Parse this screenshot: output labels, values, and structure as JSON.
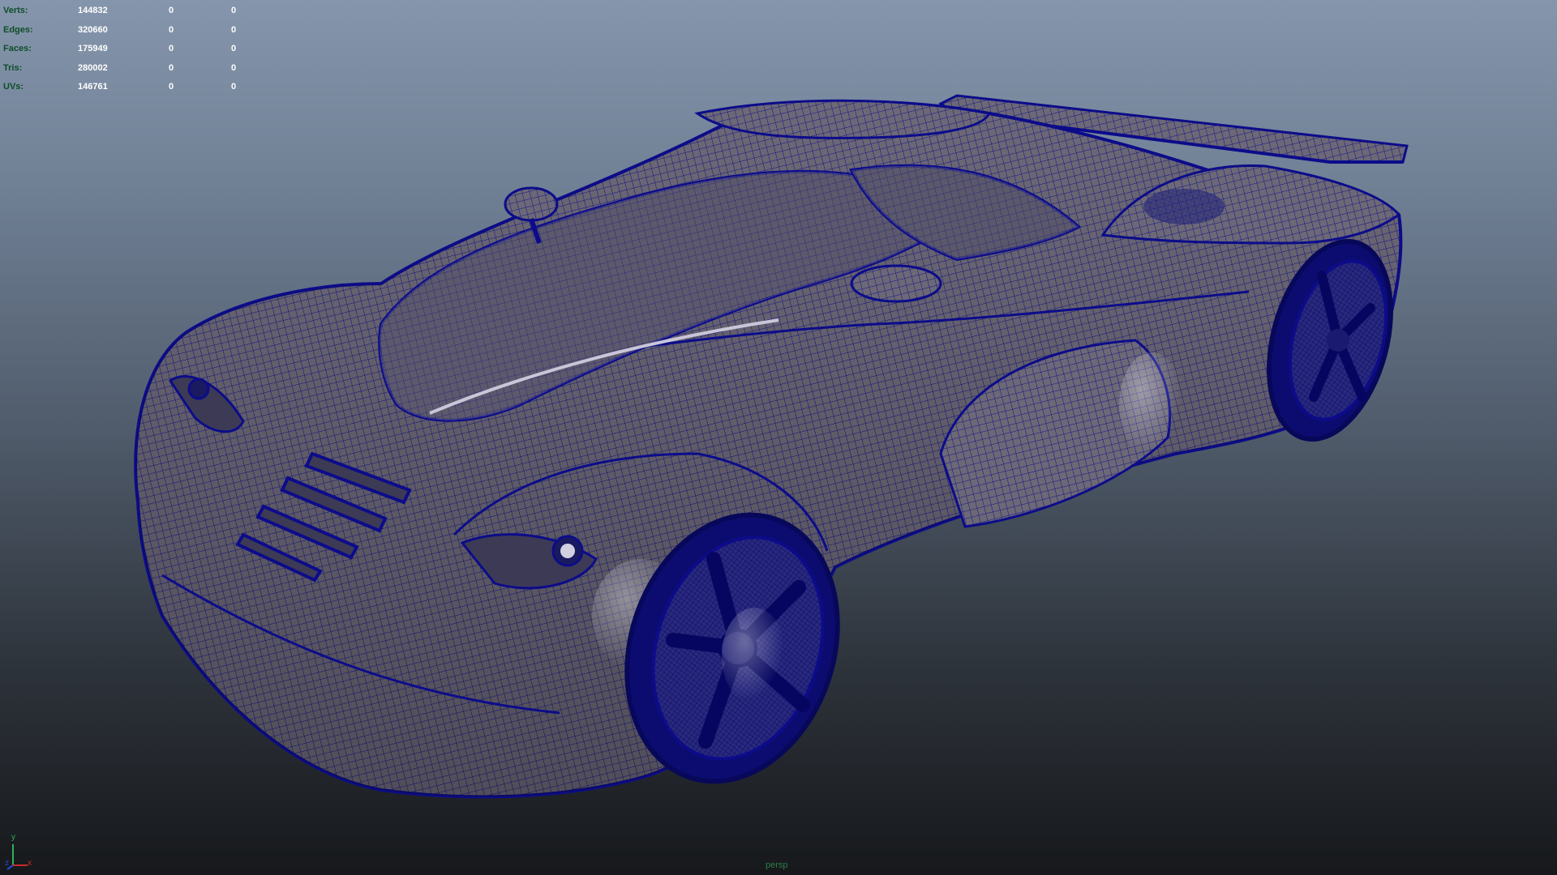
{
  "viewport": {
    "camera_name": "persp",
    "wire_color": "#0c0c8a",
    "body_color": "#6e6a76"
  },
  "hud": {
    "rows": [
      {
        "label": "Verts:",
        "value": "144832",
        "sel1": "0",
        "sel2": "0"
      },
      {
        "label": "Edges:",
        "value": "320660",
        "sel1": "0",
        "sel2": "0"
      },
      {
        "label": "Faces:",
        "value": "175949",
        "sel1": "0",
        "sel2": "0"
      },
      {
        "label": "Tris:",
        "value": "280002",
        "sel1": "0",
        "sel2": "0"
      },
      {
        "label": "UVs:",
        "value": "146761",
        "sel1": "0",
        "sel2": "0"
      }
    ]
  },
  "axis": {
    "y_label": "y",
    "x_label": "x",
    "z_label": "z"
  }
}
